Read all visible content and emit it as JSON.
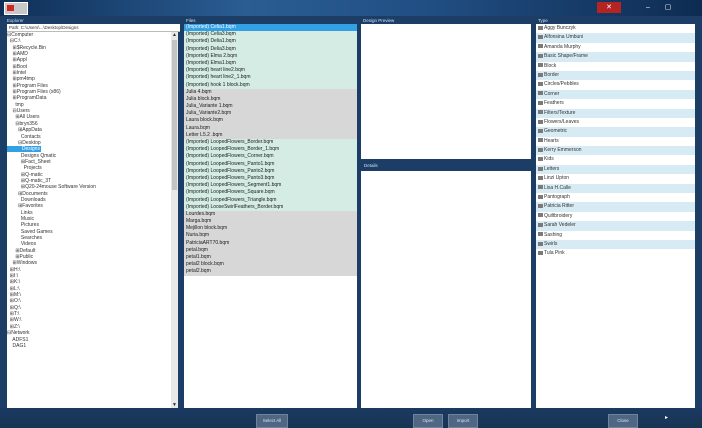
{
  "titlebar": {
    "close_glyph": "✕",
    "min_glyph": "–",
    "max_glyph": "▢"
  },
  "headers": {
    "explorer": "Explorer",
    "files": "Files",
    "design_preview": "Design Preview",
    "details": "Details",
    "groups": "Type"
  },
  "path": "Path: C:\\Users\\...\\Desktop\\Designs",
  "tree": [
    "⊟Computer",
    "  ⊟C:\\",
    "    ⊞$Recycle.Bin",
    "    ⊞AMD",
    "    ⊞Appl",
    "    ⊞Boot",
    "    ⊞Intel",
    "    ⊞pm4tmp",
    "    ⊞Program Files",
    "    ⊞Program Files (x86)",
    "    ⊞ProgramData",
    "      tmp",
    "    ⊟Users",
    "      ⊞All Users",
    "      ⊟bryn356",
    "        ⊞AppData",
    "          Contacts",
    "        ⊟Desktop",
    "          Designs",
    "          Designs Qmatic",
    "          ⊞Fact_Sheet",
    "            Projects",
    "          ⊞Q-matic",
    "          ⊞Q-matic_3T",
    "          ⊞Q20-24mouse Software Version",
    "        ⊞Documents",
    "          Downloads",
    "        ⊞Favorites",
    "          Links",
    "          Music",
    "          Pictures",
    "          Saved Games",
    "          Searches",
    "          Videos",
    "      ⊞Default",
    "      ⊞Public",
    "    ⊞Windows",
    "  ⊞H:\\",
    "  ⊞I:\\",
    "  ⊞K:\\",
    "  ⊞L:\\",
    "  ⊞M:\\",
    "  ⊞O:\\",
    "  ⊞Q:\\",
    "  ⊞T:\\",
    "  ⊞W:\\",
    "  ⊞Z:\\",
    "⊟Network",
    "    ADFS1",
    "    DAG1"
  ],
  "tree_selected_index": 18,
  "files": [
    {
      "name": "(Imported) Celia1.bqm",
      "kind": "sel"
    },
    {
      "name": "(Imported) Celia3.bqm",
      "kind": "imp"
    },
    {
      "name": "(Imported) Delia1.bqm",
      "kind": "imp"
    },
    {
      "name": "(Imported) Delia3.bqm",
      "kind": "imp"
    },
    {
      "name": "(Imported) Elma 2.bqm",
      "kind": "imp"
    },
    {
      "name": "(Imported) Elma1.bqm",
      "kind": "imp"
    },
    {
      "name": "(Imported) heart line2.bqm",
      "kind": "imp"
    },
    {
      "name": "(Imported) heart line2_1.bqm",
      "kind": "imp"
    },
    {
      "name": "(Imported) hook 1 block.bqm",
      "kind": "imp"
    },
    {
      "name": "Julia 4.bqm",
      "kind": "norm"
    },
    {
      "name": "Julia block.bqm",
      "kind": "norm"
    },
    {
      "name": "Julia_Variante 1.bqm",
      "kind": "norm"
    },
    {
      "name": "Julia_Variante2.bqm",
      "kind": "norm"
    },
    {
      "name": "Laura block.bqm",
      "kind": "norm"
    },
    {
      "name": "Laura.bqm",
      "kind": "norm"
    },
    {
      "name": "Letter L5.2 .bqm",
      "kind": "norm"
    },
    {
      "name": "(Imported) LoopedFlowers_Border.bqm",
      "kind": "imp"
    },
    {
      "name": "(Imported) LoopedFlowers_Border_1.bqm",
      "kind": "imp"
    },
    {
      "name": "(Imported) LoopedFlowers_Corner.bqm",
      "kind": "imp"
    },
    {
      "name": "(Imported) LoopedFlowers_Panto1.bqm",
      "kind": "imp"
    },
    {
      "name": "(Imported) LoopedFlowers_Panto2.bqm",
      "kind": "imp"
    },
    {
      "name": "(Imported) LoopedFlowers_Panto3.bqm",
      "kind": "imp"
    },
    {
      "name": "(Imported) LoopedFlowers_Segment1.bqm",
      "kind": "imp"
    },
    {
      "name": "(Imported) LoopedFlowers_Square.bqm",
      "kind": "imp"
    },
    {
      "name": "(Imported) LoopedFlowers_Triangle.bqm",
      "kind": "imp"
    },
    {
      "name": "(Imported) LooseSwirlFeathers_Border.bqm",
      "kind": "imp"
    },
    {
      "name": "Lourdes.bqm",
      "kind": "norm"
    },
    {
      "name": "Marga.bqm",
      "kind": "norm"
    },
    {
      "name": "Mejillon block.bqm",
      "kind": "norm"
    },
    {
      "name": "Nuria.bqm",
      "kind": "norm"
    },
    {
      "name": "PatriciaART70.bqm",
      "kind": "norm"
    },
    {
      "name": "petal.bqm",
      "kind": "norm"
    },
    {
      "name": "petal1.bqm",
      "kind": "norm"
    },
    {
      "name": "petal2 block.bqm",
      "kind": "norm"
    },
    {
      "name": "petal2.bqm",
      "kind": "norm"
    }
  ],
  "groups": [
    "Aggy Bunczyk",
    "Alfonsina Umbuni",
    "Amanda Murphy",
    "Basic Shape/Frame",
    "Block",
    "Border",
    "Circles/Pebbles",
    "Corner",
    "Feathers",
    "Filters/Texture",
    "Flowers/Leaves",
    "Geometric",
    "Hearts",
    "Kerry Emmerson",
    "Kids",
    "Letters",
    "Linzi Upton",
    "Lisa H.Calle",
    "Pantograph",
    "Patricia Ritter",
    "Quiltbroidery",
    "Sarah Vedeler",
    "Sashing",
    "Swirls",
    "Tula Pink"
  ],
  "buttons": {
    "select_all": "Select All",
    "open": "Open",
    "import": "Import",
    "close": "Close"
  },
  "colors": {
    "selection": "#33a0e6",
    "imported_row": "#d4ece4",
    "normal_row": "#d7d7d7",
    "window_bg": "#1c3d66",
    "close_button": "#b52323"
  }
}
